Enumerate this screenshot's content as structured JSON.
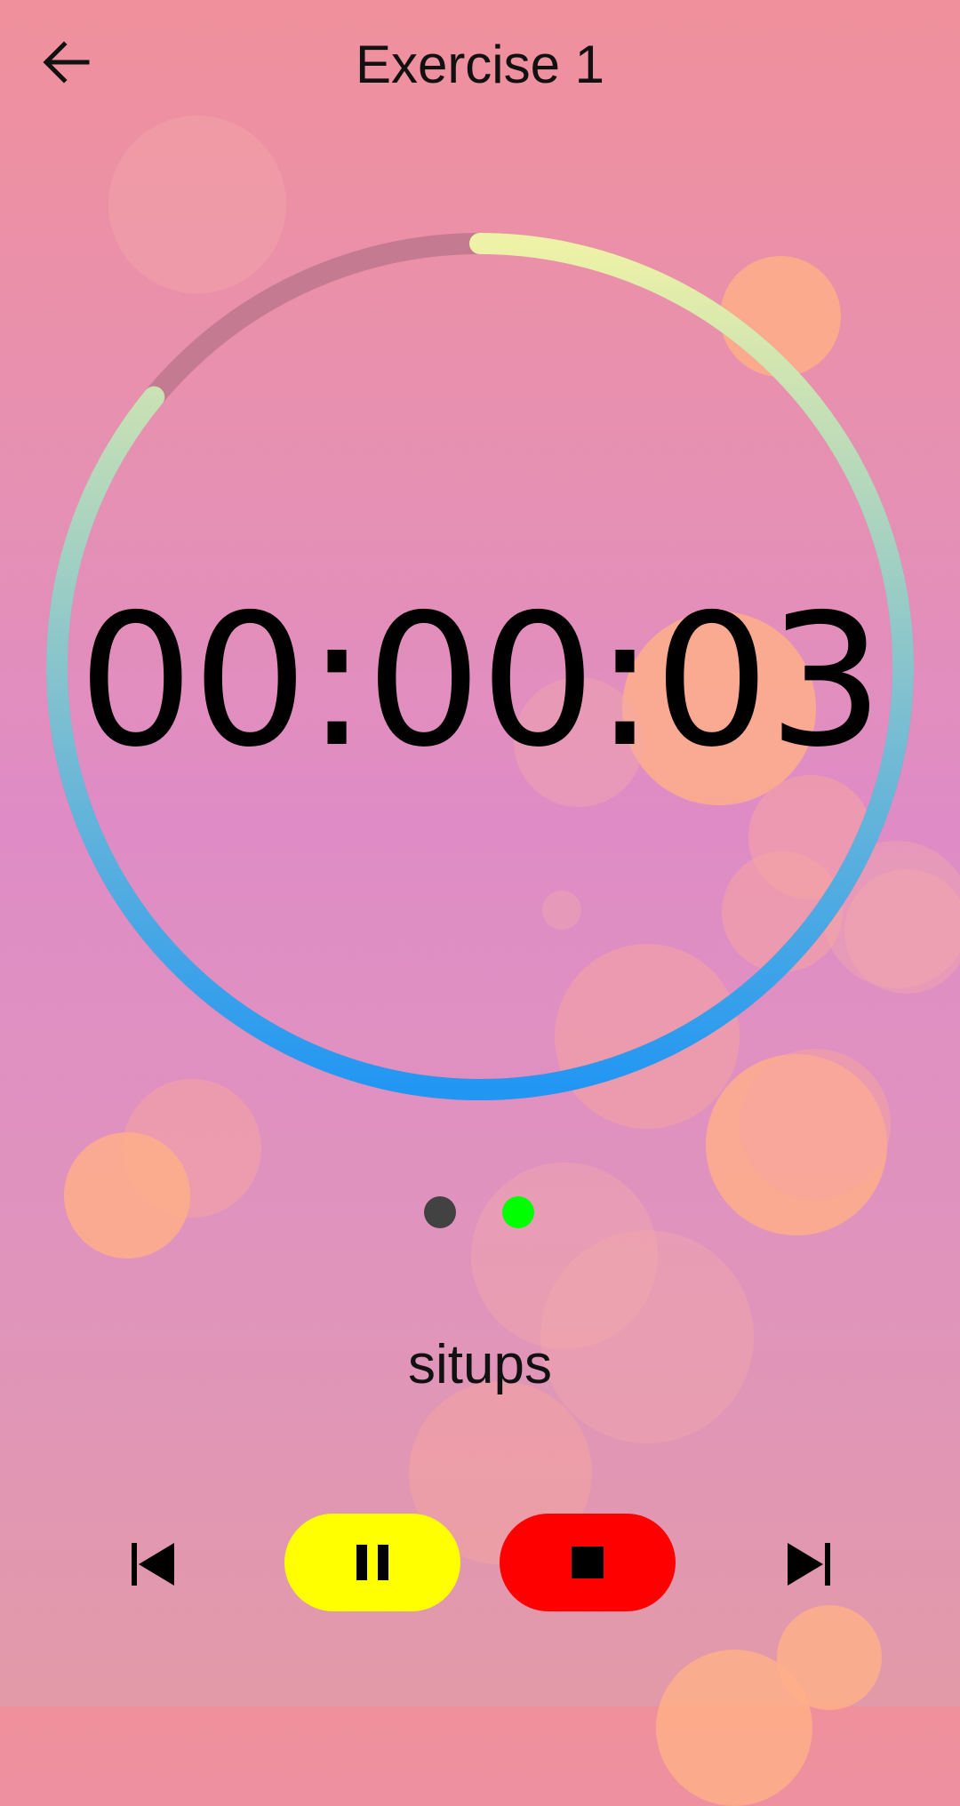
{
  "header": {
    "title": "Exercise 1",
    "back_icon": "arrow-left-icon"
  },
  "timer": {
    "display": "00:00:03",
    "progress_fraction": 0.86,
    "ring_colors": {
      "start": "#eef2a6",
      "end": "#2196f3",
      "track": "#c47a90"
    }
  },
  "page_indicator": {
    "pages": 2,
    "active_index": 1,
    "inactive_color": "#424242",
    "active_color": "#00ff00"
  },
  "exercise": {
    "name": "situps"
  },
  "controls": {
    "previous_icon": "skip-previous-icon",
    "pause_icon": "pause-icon",
    "stop_icon": "stop-icon",
    "next_icon": "skip-next-icon",
    "pause_color": "#ffff00",
    "stop_color": "#ff0000"
  },
  "colors": {
    "text": "#111111"
  }
}
